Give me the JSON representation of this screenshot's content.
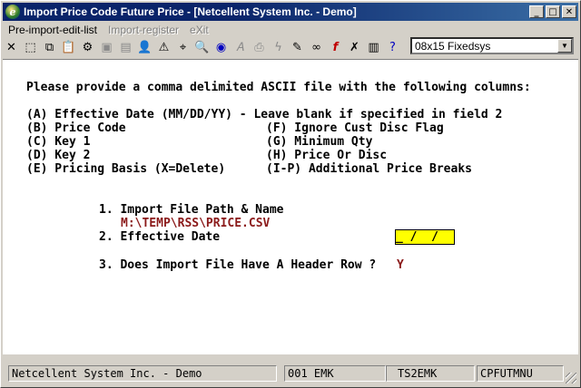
{
  "window": {
    "title": "Import Price Code Future Price - [Netcellent System Inc. - Demo]",
    "app_icon_glyph": "e",
    "buttons": {
      "minimize": "_",
      "maximize": "□",
      "close": "✕"
    }
  },
  "menu": {
    "items": [
      {
        "label": "Pre-import-edit-list",
        "enabled": true
      },
      {
        "label": "Import-register",
        "enabled": false
      },
      {
        "label": "eXit",
        "enabled": false
      }
    ]
  },
  "toolbar": {
    "icons": [
      "close-icon",
      "select-icon",
      "copy-icon",
      "paste-icon",
      "settings-icon",
      "window-icon",
      "list-icon",
      "lookup-icon",
      "alert-icon",
      "binoculars-icon",
      "zoom-icon",
      "globe-icon",
      "font-icon",
      "print-icon",
      "lightning-icon",
      "edit-icon",
      "link-icon",
      "function-icon",
      "delete-icon",
      "notepad-icon",
      "help-icon"
    ],
    "font_select": {
      "value": "08x15 Fixedsys"
    }
  },
  "content": {
    "instructions": "Please provide a comma delimited ASCII file with the following columns:",
    "columns_left": [
      "(A) Effective Date (MM/DD/YY) - Leave blank if specified in field 2",
      "(B) Price Code",
      "(C) Key 1",
      "(D) Key 2",
      "(E) Pricing Basis (X=Delete)"
    ],
    "columns_right": [
      "",
      "(F) Ignore Cust Disc Flag",
      "(G) Minimum Qty",
      "(H) Price Or Disc",
      "(I-P) Additional Price Breaks"
    ],
    "fields": [
      {
        "label": "1. Import File Path & Name",
        "value": "M:\\TEMP\\RSS\\PRICE.CSV"
      },
      {
        "label": "2. Effective Date",
        "value": "_ /  /"
      },
      {
        "label": "3. Does Import File Have A Header Row ?",
        "value": "Y"
      }
    ]
  },
  "status": {
    "company": "Netcellent System Inc. - Demo",
    "user": "001 EMK",
    "session": "TS2EMK",
    "program": "CPFUTMNU"
  },
  "colors": {
    "titlebar": "#0a246a",
    "window": "#d4d0c8",
    "value_text": "#8b1a1a",
    "date_field": "#ffff00"
  }
}
